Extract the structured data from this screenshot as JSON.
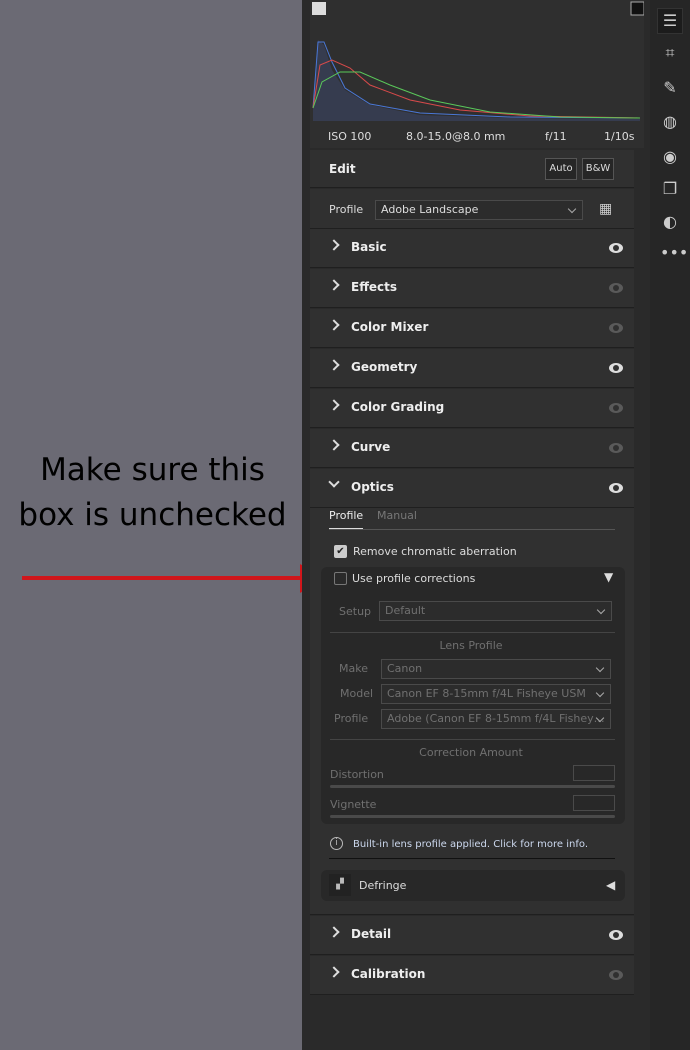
{
  "annotation": {
    "text": "Make sure this box is unchecked",
    "arrow_color": "#d0161b"
  },
  "histogram": {
    "iso": "ISO 100",
    "lens": "8.0-15.0@8.0 mm",
    "aperture": "f/11",
    "shutter": "1/10s"
  },
  "edit": {
    "title": "Edit",
    "auto": "Auto",
    "bw": "B&W",
    "profile_label": "Profile",
    "profile_value": "Adobe Landscape"
  },
  "sections": [
    {
      "label": "Basic",
      "visible": true
    },
    {
      "label": "Effects",
      "visible": false
    },
    {
      "label": "Color Mixer",
      "visible": false
    },
    {
      "label": "Geometry",
      "visible": true
    },
    {
      "label": "Color Grading",
      "visible": false
    },
    {
      "label": "Curve",
      "visible": false
    },
    {
      "label": "Optics",
      "visible": true
    }
  ],
  "optics": {
    "tab_profile": "Profile",
    "tab_manual": "Manual",
    "remove_ca": "Remove chromatic aberration",
    "remove_ca_checked": true,
    "use_profile": "Use profile corrections",
    "use_profile_checked": false,
    "setup_label": "Setup",
    "setup_value": "Default",
    "lens_profile": "Lens Profile",
    "make_label": "Make",
    "make_value": "Canon",
    "model_label": "Model",
    "model_value": "Canon EF 8-15mm f/4L Fisheye USM",
    "profile_label": "Profile",
    "profile_value": "Adobe (Canon EF 8-15mm f/4L Fishey…",
    "correction_amount": "Correction Amount",
    "distortion": "Distortion",
    "vignette": "Vignette",
    "info": "Built-in lens profile applied.  Click for more info.",
    "defringe": "Defringe"
  },
  "bottom_sections": [
    {
      "label": "Detail",
      "visible": true
    },
    {
      "label": "Calibration",
      "visible": false
    }
  ]
}
